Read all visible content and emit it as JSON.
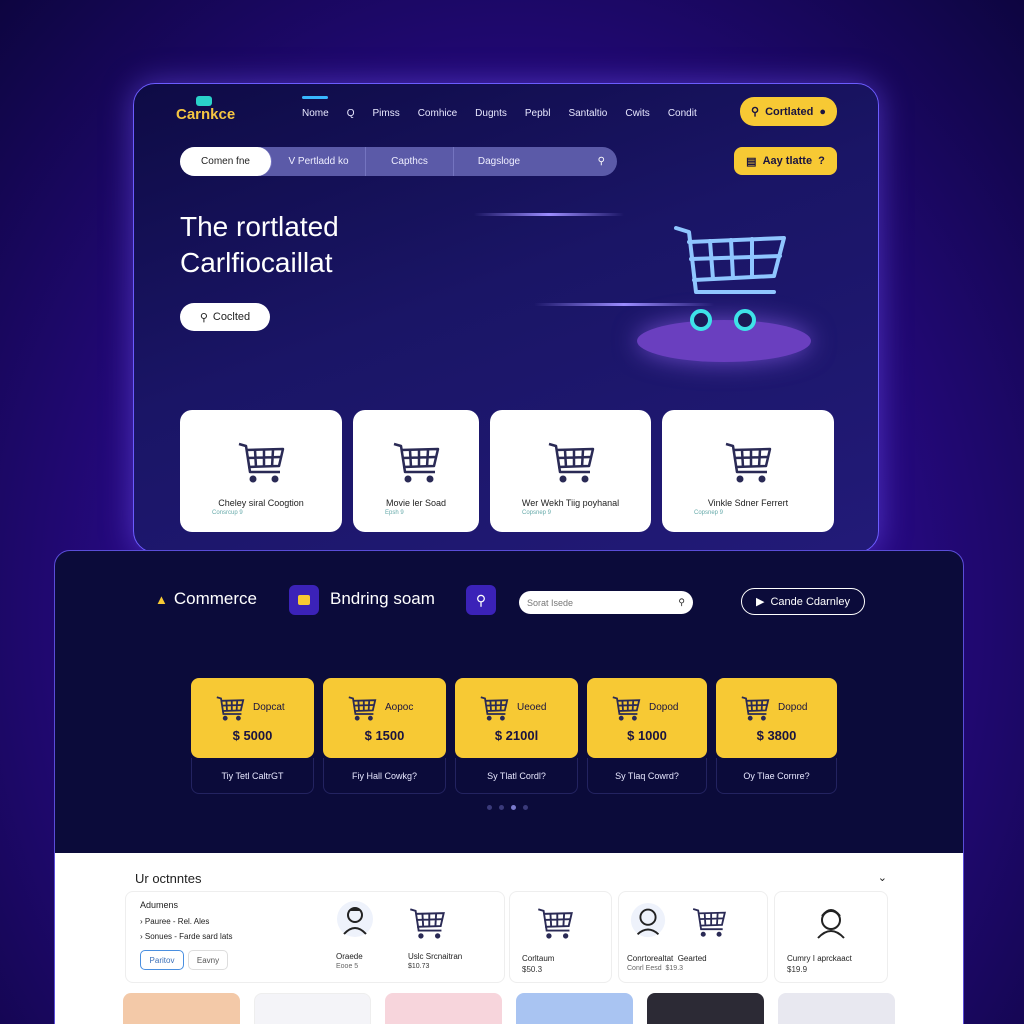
{
  "top": {
    "logo": "Carnkce",
    "logo_sub": "",
    "nav": [
      "Nome",
      "Q",
      "Pimss",
      "Comhice",
      "Dugnts",
      "Pepbl",
      "Santaltio",
      "Cwits",
      "Condit"
    ],
    "btn_primary": "Cortlated",
    "btn_secondary": "Aay tlatte",
    "search_segments": [
      "Comen fne",
      "V Pertladd ko",
      "Capthcs",
      "Dagsloge"
    ],
    "hero_line1": "The rortlated",
    "hero_line2": "Carlfiocaillat",
    "hero_button": "Coclted",
    "cards": [
      {
        "title": "Cheley siral Coogtion",
        "sub": "Consrcup 9"
      },
      {
        "title": "Movie ler Soad",
        "sub": "Epsh 9"
      },
      {
        "title": "Wer Wekh Tiig poyhanal",
        "sub": "Copsnep 9"
      },
      {
        "title": "Vinkle Sdner Ferrert",
        "sub": "Copsnep 9"
      }
    ]
  },
  "bottom": {
    "brand": "Commerce",
    "brand2": "Bndring soam",
    "search_placeholder": "Sorat Isede",
    "outline_btn": "Cande Cdarnley",
    "products": [
      {
        "name": "Dopcat",
        "price": "$ 5000",
        "caption": "Tiy Tetl CaltrGT"
      },
      {
        "name": "Aopoc",
        "price": "$ 1500",
        "caption": "Fiy Hall Cowkg?"
      },
      {
        "name": "Ueoed",
        "price": "$ 2100l",
        "caption": "Sy Tlatl Cordl?"
      },
      {
        "name": "Dopod",
        "price": "$ 1000",
        "caption": "Sy Tlaq Cowrd?"
      },
      {
        "name": "Dopod",
        "price": "$ 3800",
        "caption": "Oy Tlae Cornre?"
      }
    ],
    "section_title": "Ur octnntes",
    "panel": {
      "title": "Adumens",
      "items": [
        "Pauree - Rel. Ales",
        "Sonues - Farde sard lats"
      ],
      "btn1": "Paritov",
      "btn2": "Eavny"
    },
    "minis": [
      {
        "l1": "Oraede",
        "l2": "Eooe 5",
        "kind": "person"
      },
      {
        "l1": "Uslc Srcnaitran",
        "l2": "$10.73",
        "kind": "cart"
      },
      {
        "l1": "Corltaum",
        "l2": "$50.3",
        "kind": "cart"
      },
      {
        "l1": "Conrtorealtat  Gearted",
        "l2": "Conrl Eesd  $19.3",
        "kind": "both"
      },
      {
        "l1": "Cumry I aprckaact",
        "l2": "$19.9",
        "kind": "person"
      }
    ],
    "thumb_colors": [
      "#f3c9a8",
      "#f4f4f8",
      "#f7d5dc",
      "#a9c4f2",
      "#2c2a35",
      "#e8e8f0"
    ]
  }
}
